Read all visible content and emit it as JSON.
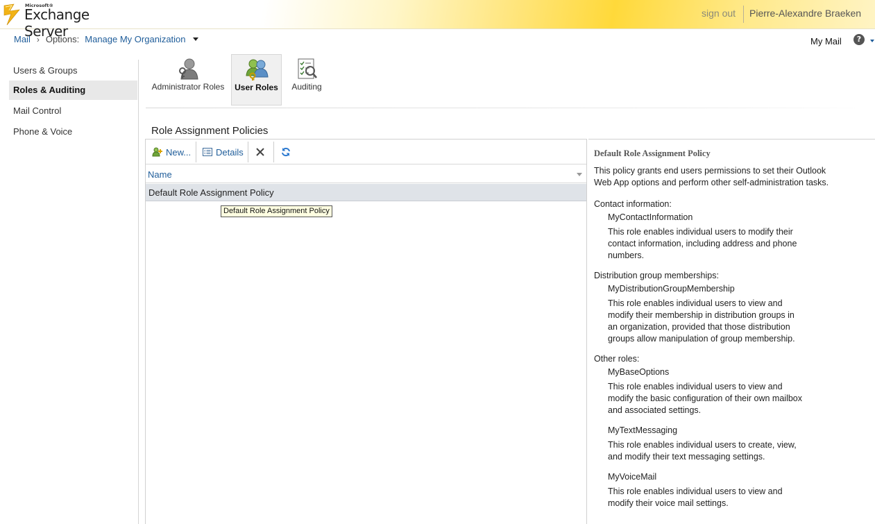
{
  "brand": {
    "small": "Microsoft®",
    "name": "Exchange Server"
  },
  "header": {
    "sign_out": "sign out",
    "user_name": "Pierre-Alexandre Braeken"
  },
  "breadcrumb": {
    "mail": "Mail",
    "options_label": "Options:",
    "current": "Manage My Organization"
  },
  "my_mail": "My Mail",
  "help": "?",
  "sidebar": {
    "items": [
      {
        "label": "Users & Groups",
        "active": false
      },
      {
        "label": "Roles & Auditing",
        "active": true
      },
      {
        "label": "Mail Control",
        "active": false
      },
      {
        "label": "Phone & Voice",
        "active": false
      }
    ]
  },
  "ribbon": {
    "admin_roles": "Administrator Roles",
    "user_roles": "User Roles",
    "auditing": "Auditing"
  },
  "section_title": "Role Assignment Policies",
  "toolbar": {
    "new_label": "New...",
    "details_label": "Details"
  },
  "list": {
    "column_name": "Name",
    "rows": [
      "Default Role Assignment Policy"
    ],
    "tooltip": "Default Role Assignment Policy"
  },
  "detail": {
    "title": "Default Role Assignment Policy",
    "description_1": "This policy grants end users permissions to set their Outlook",
    "description_2": "Web App options and perform other self-administration tasks.",
    "contact_heading": "Contact information:",
    "contact_role": "MyContactInformation",
    "contact_desc_1": "This role enables individual users to modify their",
    "contact_desc_2": "contact information, including address and phone",
    "contact_desc_3": "numbers.",
    "dist_heading": "Distribution group memberships:",
    "dist_role": "MyDistributionGroupMembership",
    "dist_desc_1": "This role enables individual users to view and",
    "dist_desc_2": "modify their membership in distribution groups in",
    "dist_desc_3": "an organization, provided that those distribution",
    "dist_desc_4": "groups allow manipulation of group membership.",
    "other_heading": "Other roles:",
    "base_role": "MyBaseOptions",
    "base_desc_1": "This role enables individual users to view and",
    "base_desc_2": "modify the basic configuration of their own mailbox",
    "base_desc_3": "and associated settings.",
    "text_role": "MyTextMessaging",
    "text_desc_1": "This role enables individual users to create, view,",
    "text_desc_2": "and modify their text messaging settings.",
    "voice_role": "MyVoiceMail",
    "voice_desc_1": "This role enables individual users to view and",
    "voice_desc_2": "modify their voice mail settings."
  },
  "colors": {
    "link": "#1f5d9a",
    "accent_yellow": "#ffd93a",
    "selected_row": "#dfe3e8"
  },
  "icons": [
    "exchange-logo-icon",
    "admin-roles-icon",
    "user-roles-icon",
    "auditing-icon",
    "new-icon",
    "details-icon",
    "delete-icon",
    "refresh-icon",
    "help-icon"
  ]
}
